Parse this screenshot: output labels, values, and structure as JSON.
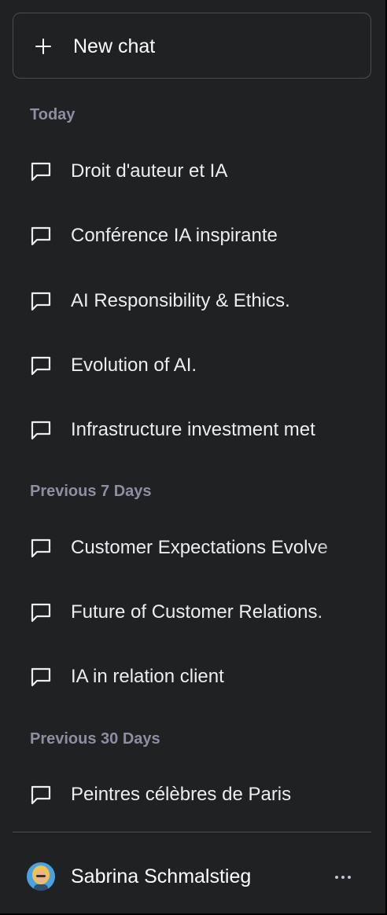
{
  "sidebar": {
    "new_chat_label": "New chat",
    "sections": [
      {
        "title": "Today",
        "items": [
          "Droit d'auteur et IA",
          "Conférence IA inspirante",
          "AI Responsibility & Ethics.",
          "Evolution of AI.",
          "Infrastructure investment met"
        ]
      },
      {
        "title": "Previous 7 Days",
        "items": [
          "Customer Expectations Evolve",
          "Future of Customer Relations.",
          "IA in relation client"
        ]
      },
      {
        "title": "Previous 30 Days",
        "items": [
          "Peintres célèbres de Paris"
        ]
      }
    ],
    "user": {
      "name": "Sabrina Schmalstieg",
      "avatar_icon": "user-avatar"
    },
    "icons": {
      "new_chat": "plus-icon",
      "chat_item": "chat-bubble-icon",
      "more": "more-horizontal-icon"
    },
    "colors": {
      "background": "#202123",
      "text": "#ececf1",
      "muted": "#8e8ea0",
      "border": "#4d4d4f"
    }
  }
}
